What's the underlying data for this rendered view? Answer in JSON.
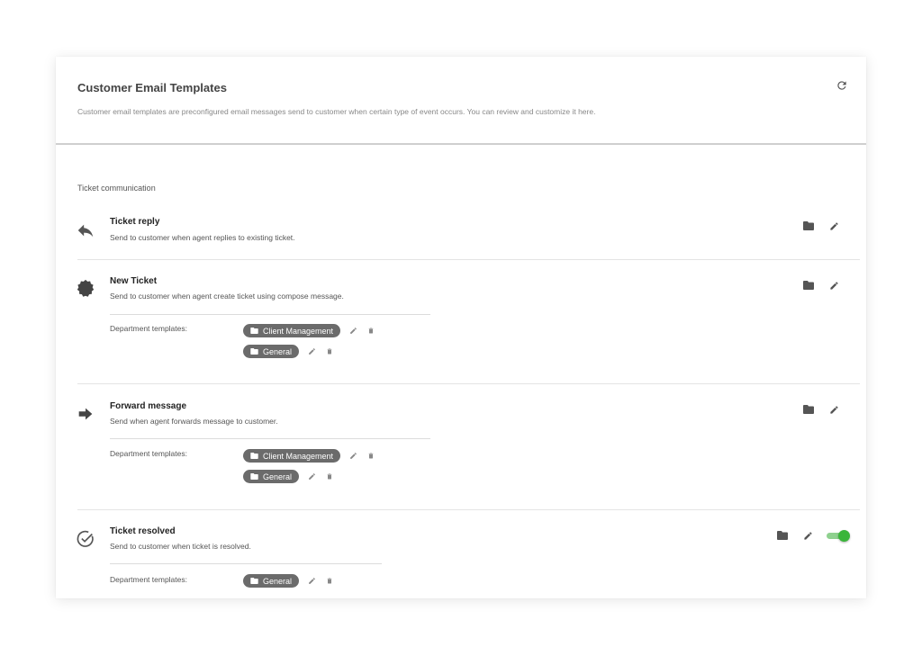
{
  "header": {
    "title": "Customer Email Templates",
    "description": "Customer email templates are preconfigured email messages send to customer when certain type of event occurs. You can review and customize it here."
  },
  "section": {
    "label": "Ticket communication"
  },
  "templates": [
    {
      "title": "Ticket reply",
      "description": "Send to customer when agent replies to existing ticket.",
      "icon": "reply-icon"
    },
    {
      "title": "New Ticket",
      "description": "Send to customer when agent create ticket using compose message.",
      "icon": "badge-icon",
      "dept_label": "Department templates:",
      "chips": [
        "Client Management",
        "General"
      ]
    },
    {
      "title": "Forward message",
      "description": "Send when agent forwards message to customer.",
      "icon": "forward-arrow-icon",
      "dept_label": "Department templates:",
      "chips": [
        "Client Management",
        "General"
      ]
    },
    {
      "title": "Ticket resolved",
      "description": "Send to customer when ticket is resolved.",
      "icon": "check-circle-icon",
      "dept_label": "Department templates:",
      "chips": [
        "General"
      ],
      "toggle_on": true
    }
  ],
  "colors": {
    "toggle_on": "#3ab53a",
    "chip_bg": "#6b6b6b"
  }
}
